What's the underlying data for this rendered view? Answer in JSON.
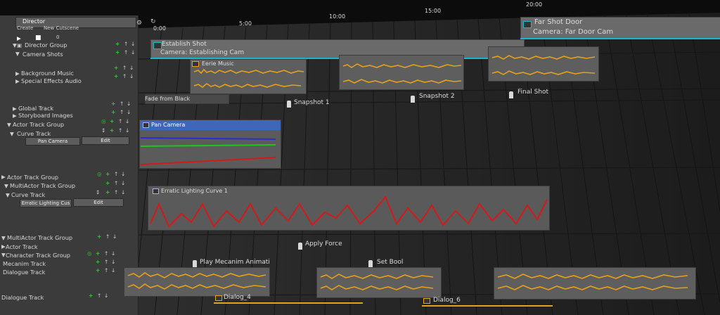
{
  "window": {
    "tab_title": "Director",
    "menu_create": "Create",
    "menu_cutscene": "New Cutscene"
  },
  "transport": {
    "frame_value": "0"
  },
  "ruler": {
    "ticks": [
      "0:00",
      "5:00",
      "10:00",
      "15:00",
      "20:00"
    ]
  },
  "tracks": [
    {
      "label": "Director Group"
    },
    {
      "label": "Camera Shots"
    },
    {
      "label": "Background Music"
    },
    {
      "label": "Special Effects Audio"
    },
    {
      "label": "Global Track"
    },
    {
      "label": "Storyboard Images"
    },
    {
      "label": "Actor Track Group"
    },
    {
      "label": "Curve Track"
    },
    {
      "label": "Actor Track Group"
    },
    {
      "label": "MultiActor Track Group"
    },
    {
      "label": "Curve Track"
    },
    {
      "label": "MultiActor Track Group"
    },
    {
      "label": "Actor Track"
    },
    {
      "label": "Character Track Group"
    },
    {
      "label": "Mecanim Track"
    },
    {
      "label": "Dialogue Track"
    },
    {
      "label": "Dialogue Track"
    }
  ],
  "curve1": {
    "dropdown": "Pan Camera",
    "edit": "Edit"
  },
  "curve2": {
    "dropdown": "Erratic Lighting Cus",
    "edit": "Edit"
  },
  "clips": {
    "shot1_title": "Establish Shot",
    "shot1_cam": "Camera: Establishing Cam",
    "shot2_title": "Far Shot Door",
    "shot2_cam": "Camera: Far Door Cam",
    "music": "Eerie Music",
    "fade": "Fade from Black",
    "snap1": "Snapshot 1",
    "snap2": "Snapshot 2",
    "final": "Final Shot",
    "pan": "Pan Camera",
    "erratic": "Erratic Lighting Curve 1",
    "apply": "Apply Force",
    "play": "Play Mecanim Animati",
    "setbool": "Set Bool",
    "dialog4": "Dialog_4",
    "dialog6": "Dialog_6"
  },
  "colors": {
    "accent_cyan": "#17b7c8",
    "accent_orange": "#e6a11a",
    "curve_red": "#d11a1a",
    "curve_green": "#1ec41e",
    "curve_blue": "#2b2bd6",
    "pan_header": "#3f67b8"
  }
}
